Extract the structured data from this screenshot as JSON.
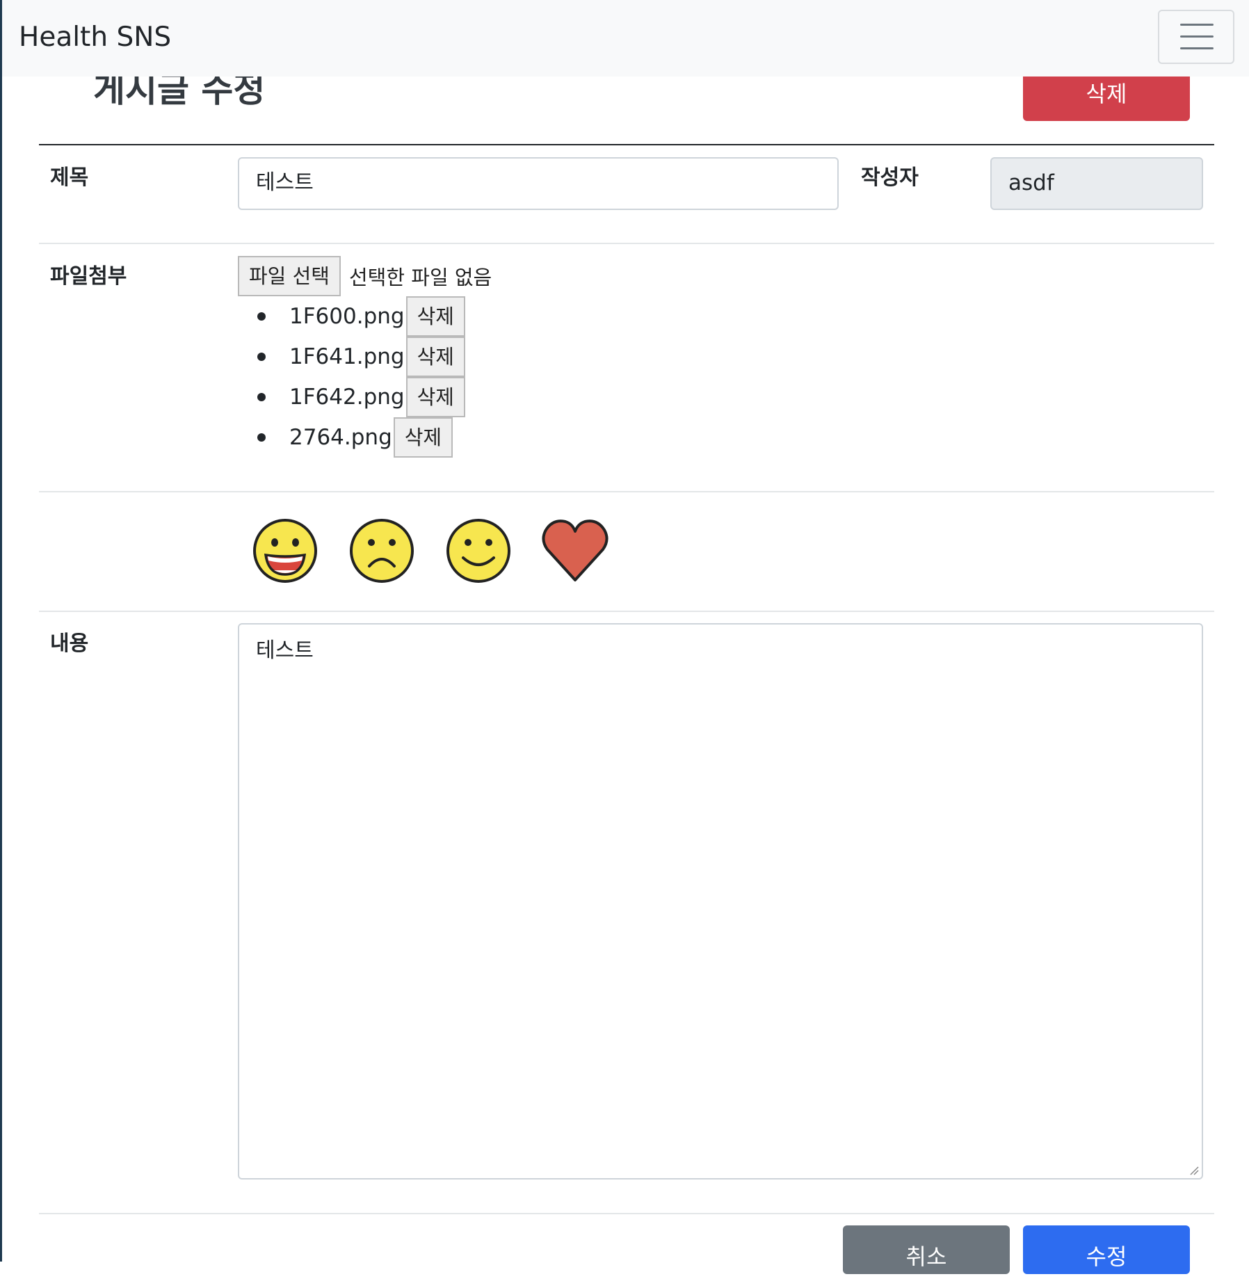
{
  "navbar": {
    "brand": "Health SNS",
    "toggler_icon": "hamburger-icon"
  },
  "page": {
    "title": "게시글 수정",
    "delete_label": "삭제"
  },
  "form": {
    "title_label": "제목",
    "title_value": "테스트",
    "author_label": "작성자",
    "author_value": "asdf",
    "attach_label": "파일첨부",
    "file_button_label": "파일 선택",
    "file_status": "선택한 파일 없음",
    "files": [
      {
        "name": "1F600.png",
        "delete_label": "삭제"
      },
      {
        "name": "1F641.png",
        "delete_label": "삭제"
      },
      {
        "name": "1F642.png",
        "delete_label": "삭제"
      },
      {
        "name": "2764.png",
        "delete_label": "삭제"
      }
    ],
    "emojis": [
      "grinning-face-icon",
      "frowning-face-icon",
      "slightly-smiling-face-icon",
      "red-heart-icon"
    ],
    "content_label": "내용",
    "content_value": "테스트"
  },
  "actions": {
    "cancel_label": "취소",
    "submit_label": "수정"
  },
  "colors": {
    "danger": "#d1404b",
    "primary": "#2d6cf0",
    "secondary": "#6c757d",
    "emoji_yellow": "#f7e64f",
    "heart_red": "#d9614f"
  }
}
